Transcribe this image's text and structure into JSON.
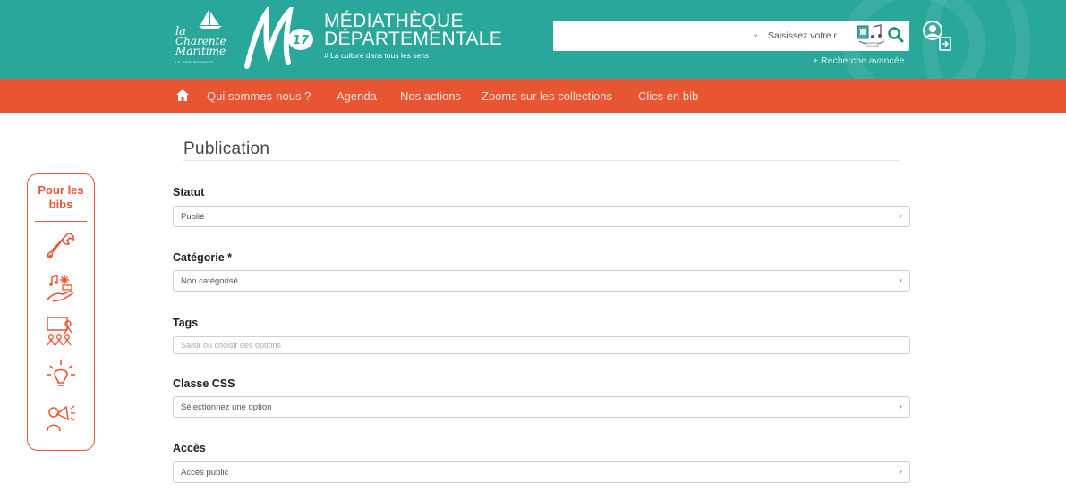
{
  "header": {
    "cm_logo": {
      "line1": "la",
      "line2": "Charente",
      "line3": "Maritime",
      "dept": "LE DÉPARTEMENT"
    },
    "md_logo": {
      "text": "MD 17"
    },
    "title_line1": "MÉDIATHÈQUE",
    "title_line2": "DÉPARTEMENTALE",
    "tagline": "# La culture dans tous les sens",
    "search": {
      "placeholder": "Saisissez votre r"
    },
    "advanced_search": "+ Recherche avancée",
    "icons": {
      "home": "home-icon",
      "user": "user-login-icon",
      "search": "magnifier-icon",
      "books": "books-music-icon"
    },
    "colors": {
      "teal": "#2aa79b",
      "orange": "#e75532"
    }
  },
  "nav": {
    "items": [
      "Qui sommes-nous ?",
      "Agenda",
      "Nos actions",
      "Zooms sur les collections",
      "Clics en bib"
    ]
  },
  "side_panel": {
    "title_line1": "Pour les",
    "title_line2": "bibs",
    "icons": [
      "wrench-icon",
      "hand-music-icon",
      "training-group-icon",
      "lightbulb-icon",
      "megaphone-person-icon"
    ]
  },
  "form": {
    "section_title": "Publication",
    "fields": [
      {
        "label": "Statut",
        "value": "Publié"
      },
      {
        "label": "Catégorie *",
        "value": "Non catégorisé"
      },
      {
        "label": "Tags",
        "placeholder": "Saisir ou choisir des options"
      },
      {
        "label": "Classe CSS",
        "value": "Sélectionnez une option"
      },
      {
        "label": "Accès",
        "value": "Accès public"
      }
    ]
  }
}
